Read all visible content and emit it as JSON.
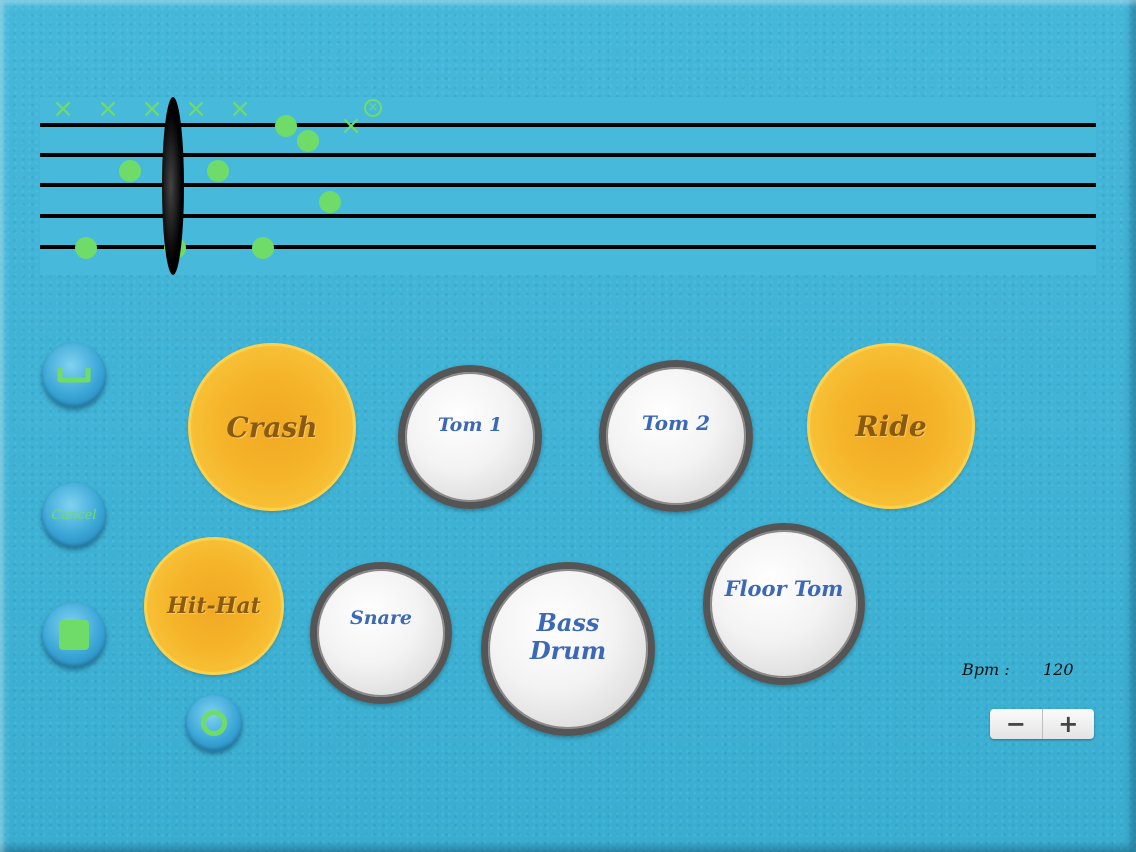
{
  "pads": {
    "crash": "Crash",
    "tom1": "Tom 1",
    "tom2": "Tom 2",
    "ride": "Ride",
    "hihat": "Hit-Hat",
    "snare": "Snare",
    "bass_line1": "Bass",
    "bass_line2": "Drum",
    "floor_tom": "Floor Tom"
  },
  "side_buttons": {
    "clear_label": "Cancel"
  },
  "tempo": {
    "label": "Bpm :",
    "value": "120",
    "decrease": "−",
    "increase": "+"
  },
  "icons": {
    "tray": "tray-icon",
    "stop": "stop-square-icon",
    "record": "record-ring-icon"
  },
  "colors": {
    "background": "#3fb3d5",
    "note": "#6fdc6a",
    "cymbal": "#f5b52a",
    "drum_text": "#3c68b8"
  }
}
